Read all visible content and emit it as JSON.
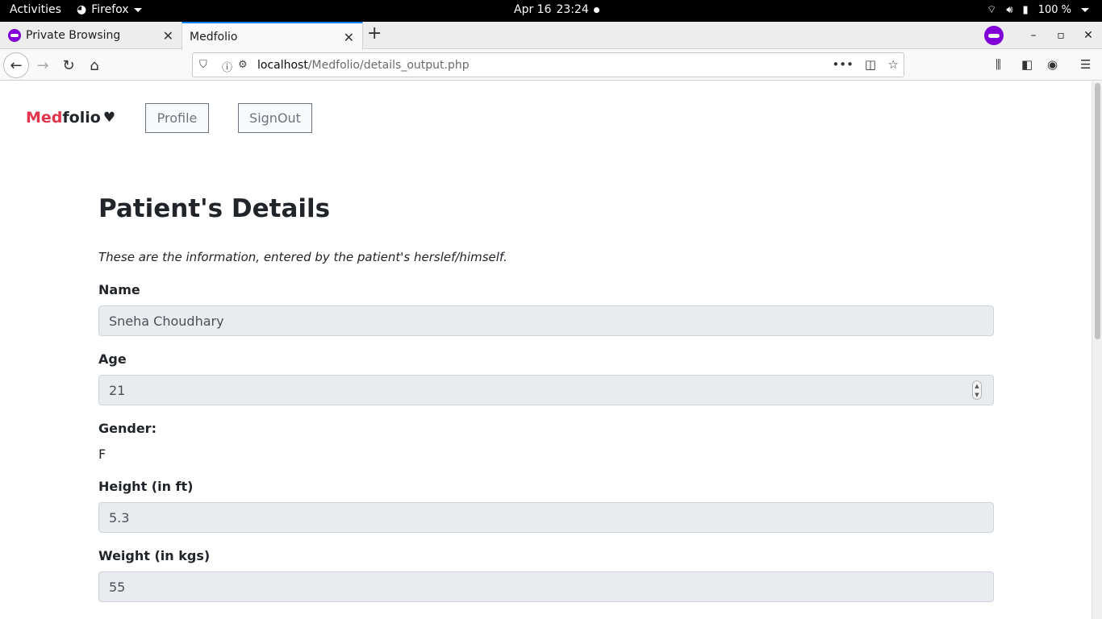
{
  "system_bar": {
    "activities": "Activities",
    "app": "Firefox",
    "date": "Apr 16",
    "time": "23:24",
    "battery": "100 %"
  },
  "tabs": [
    {
      "label": "Private Browsing",
      "active": false
    },
    {
      "label": "Medfolio",
      "active": true
    }
  ],
  "address": {
    "host": "localhost",
    "path": "/Medfolio/details_output.php"
  },
  "site": {
    "brand_first": "Med",
    "brand_second": "folio",
    "nav": {
      "profile": "Profile",
      "signout": "SignOut"
    }
  },
  "details": {
    "title": "Patient's Details",
    "subtitle": "These are the information, entered by the patient's herslef/himself.",
    "name_label": "Name",
    "name_value": "Sneha Choudhary",
    "age_label": "Age",
    "age_value": "21",
    "gender_label": "Gender:",
    "gender_value": "F",
    "height_label": "Height (in ft)",
    "height_value": "5.3",
    "weight_label": "Weight (in kgs)",
    "weight_value": "55"
  },
  "colors": {
    "brand_accent": "#e3344e",
    "private_purple": "#8000d7",
    "field_bg": "#e9ecef"
  }
}
